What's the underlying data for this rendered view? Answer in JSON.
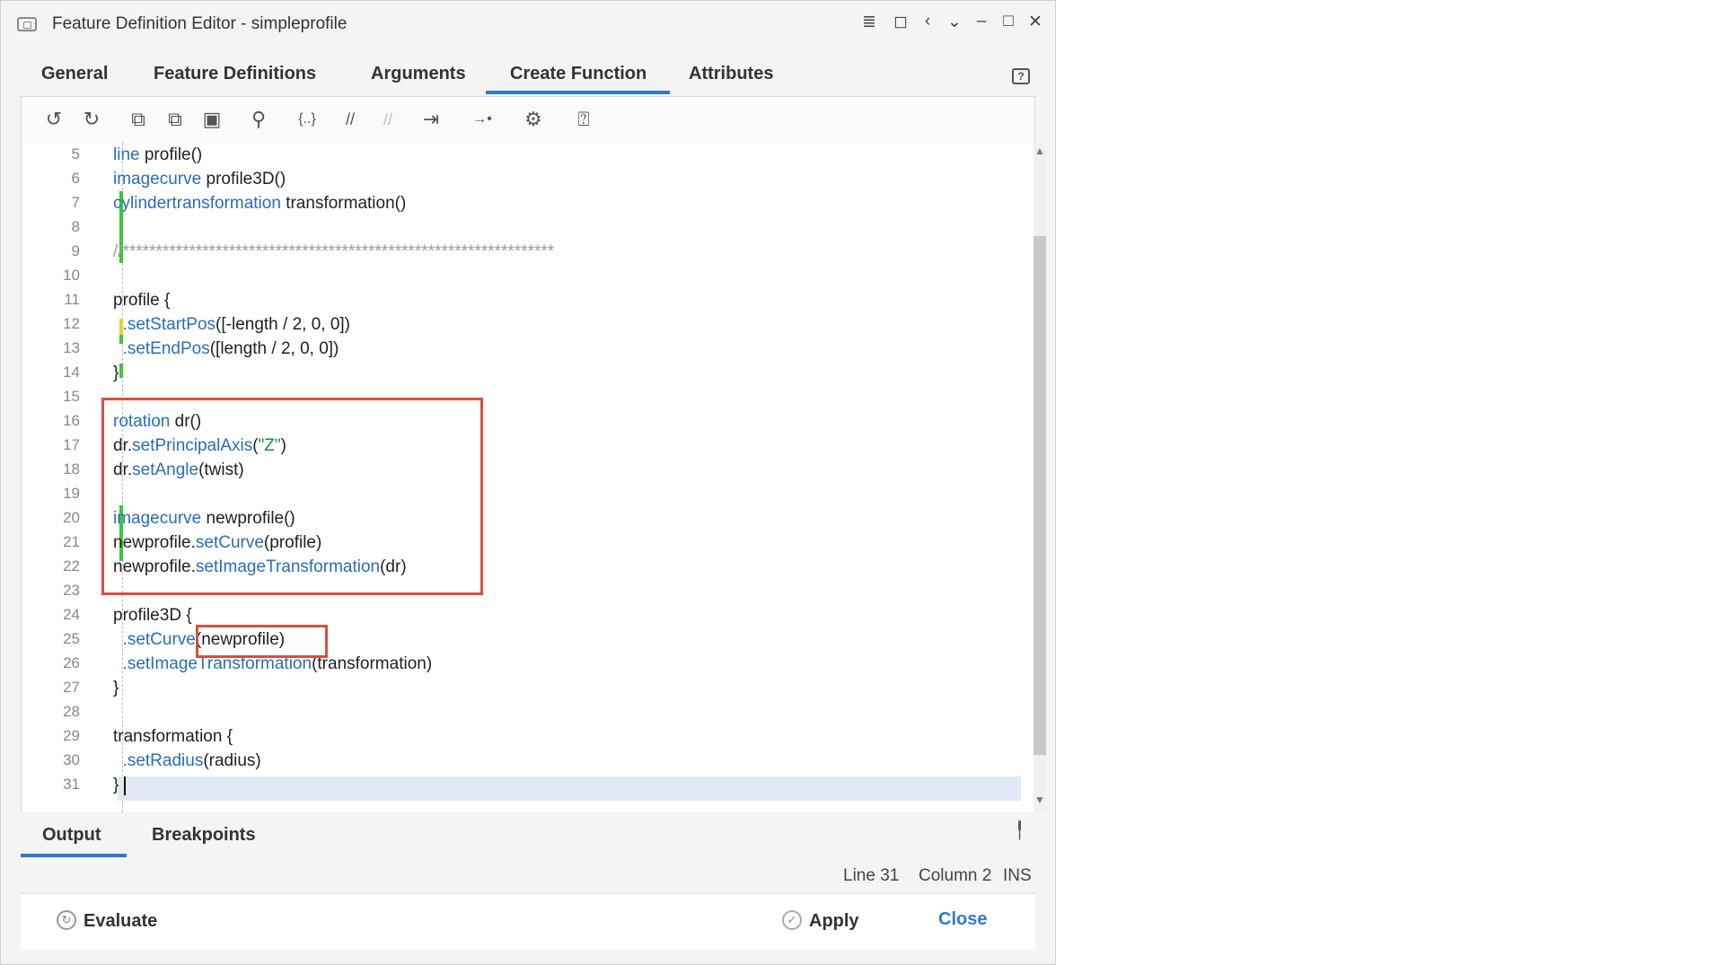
{
  "window": {
    "title": "Feature Definition Editor - simpleprofile"
  },
  "tabs": [
    {
      "label": "General"
    },
    {
      "label": "Feature Definitions"
    },
    {
      "label": "Arguments"
    },
    {
      "label": "Create Function",
      "active": true
    },
    {
      "label": "Attributes"
    }
  ],
  "toolbar_icons": [
    "undo-icon",
    "redo-icon",
    "copy-icon",
    "duplicate-icon",
    "paste-icon",
    "search-icon",
    "braces-icon",
    "comment-icon",
    "uncomment-icon",
    "indent-icon",
    "goto-icon",
    "settings-icon",
    "help-icon"
  ],
  "code": {
    "lines": [
      {
        "n": "5"
      },
      {
        "n": "6"
      },
      {
        "n": "7"
      },
      {
        "n": "8"
      },
      {
        "n": "9"
      },
      {
        "n": "10"
      },
      {
        "n": "11"
      },
      {
        "n": "12"
      },
      {
        "n": "13"
      },
      {
        "n": "14"
      },
      {
        "n": "15"
      },
      {
        "n": "16"
      },
      {
        "n": "17"
      },
      {
        "n": "18"
      },
      {
        "n": "19"
      },
      {
        "n": "20"
      },
      {
        "n": "21"
      },
      {
        "n": "22"
      },
      {
        "n": "23"
      },
      {
        "n": "24"
      },
      {
        "n": "25"
      },
      {
        "n": "26"
      },
      {
        "n": "27"
      },
      {
        "n": "28"
      },
      {
        "n": "29"
      },
      {
        "n": "30"
      },
      {
        "n": "31"
      }
    ],
    "text": {
      "l5a": "line",
      "l5b": " profile()",
      "l6a": "imagecurve",
      "l6b": " profile3D()",
      "l7a": "cylindertransformation",
      "l7b": " transformation()",
      "l9": "//*****************************************************************",
      "l11": "profile {",
      "l12a": "  .setStartPos",
      "l12b": "([-length / 2, 0, 0])",
      "l13a": "  .setEndPos",
      "l13b": "([length / 2, 0, 0])",
      "l14": "}",
      "l16a": "rotation",
      "l16b": " dr()",
      "l17a": "dr.",
      "l17b": "setPrincipalAxis",
      "l17c": "(",
      "l17d": "\"Z\"",
      "l17e": ")",
      "l18a": "dr.",
      "l18b": "setAngle",
      "l18c": "(twist)",
      "l20a": "imagecurve",
      "l20b": " newprofile()",
      "l21a": "newprofile.",
      "l21b": "setCurve",
      "l21c": "(profile)",
      "l22a": "newprofile.",
      "l22b": "setImageTransformation",
      "l22c": "(dr)",
      "l24": "profile3D {",
      "l25a": "  .setCurve",
      "l25b": "(newprofile)",
      "l26a": "  .setImageTransformation",
      "l26b": "(transformation)",
      "l27": "}",
      "l29": "transformation {",
      "l30a": "  .setRadius",
      "l30b": "(radius)",
      "l31": "}"
    }
  },
  "bottom_tabs": {
    "output": "Output",
    "breakpoints": "Breakpoints"
  },
  "status": {
    "line": "Line 31",
    "column": "Column 2",
    "mode": "INS"
  },
  "footer": {
    "evaluate": "Evaluate",
    "apply": "Apply",
    "close": "Close"
  },
  "colors": {
    "accent": "#2f7bc8",
    "highlight_box": "#d94f3d",
    "keyword": "#2a6db6",
    "string": "#1e8a3e"
  }
}
